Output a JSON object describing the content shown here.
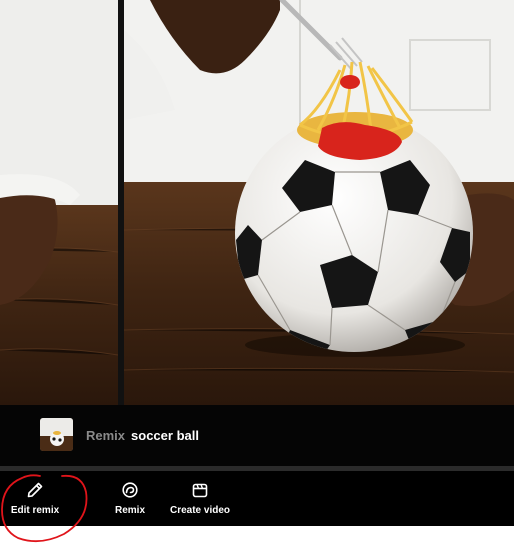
{
  "prompt": {
    "keyword": "Remix",
    "text": "soccer ball"
  },
  "toolbar": {
    "items": [
      {
        "label": "Edit remix",
        "icon": "pencil-icon"
      },
      {
        "label": "Remix",
        "icon": "remix-icon"
      },
      {
        "label": "Create video",
        "icon": "clapperboard-icon"
      }
    ]
  },
  "colors": {
    "bar_background": "#050505",
    "toolbar_background": "#000000",
    "annotation": "#e0141a"
  }
}
